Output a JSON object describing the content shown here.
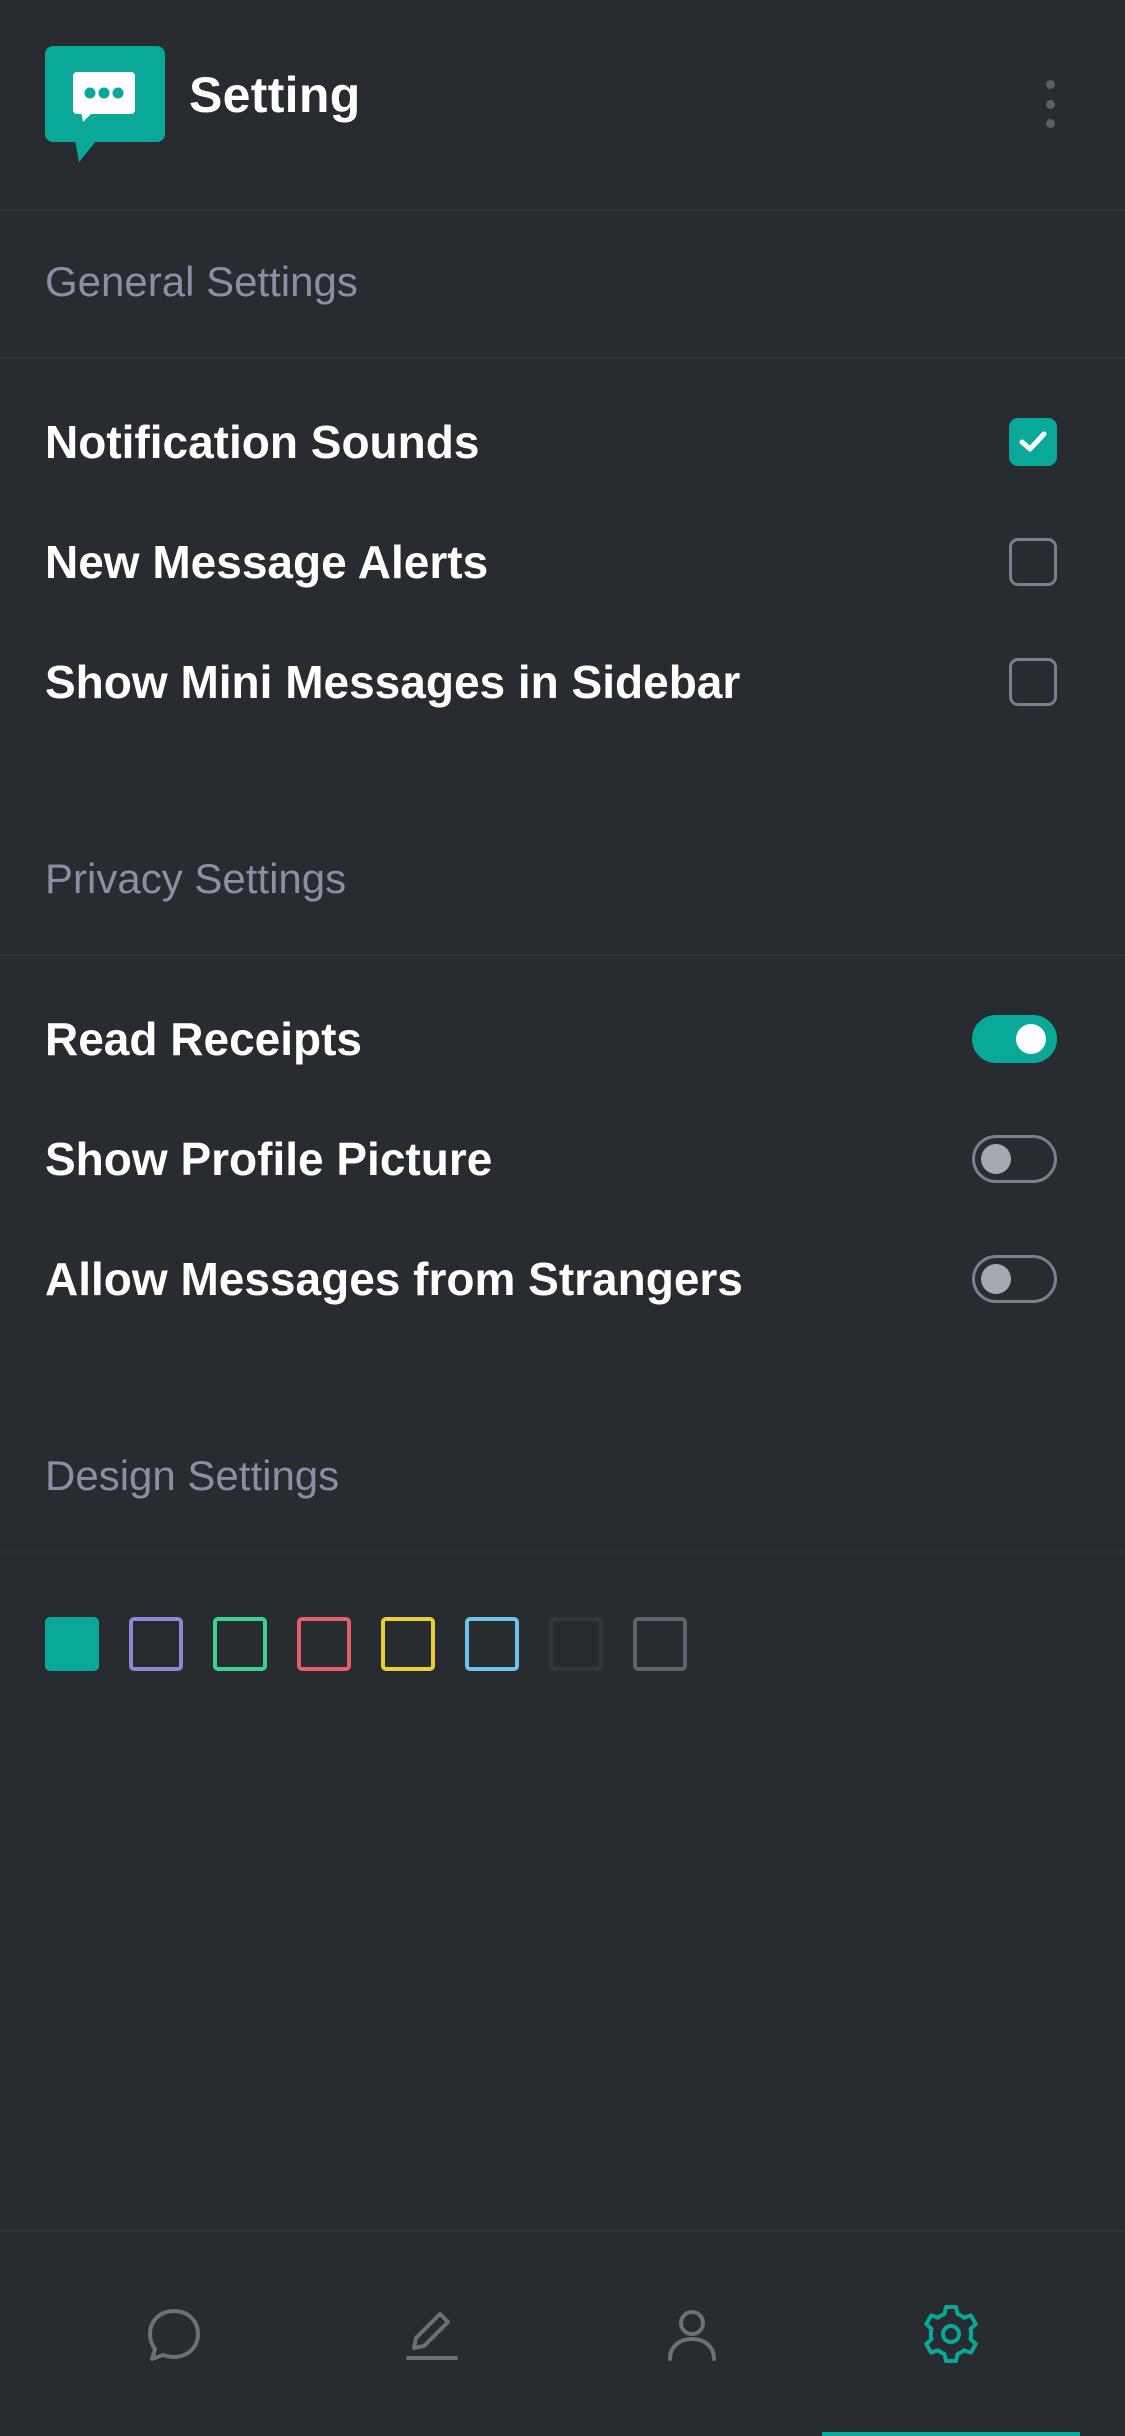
{
  "header": {
    "title": "Setting",
    "logo_icon": "chat-bubble-icon",
    "more_icon": "more-vertical-icon"
  },
  "sections": {
    "general": {
      "heading": "General Settings",
      "items": [
        {
          "label": "Notification Sounds",
          "checked": true
        },
        {
          "label": "New Message Alerts",
          "checked": false
        },
        {
          "label": "Show Mini Messages in Sidebar",
          "checked": false
        }
      ]
    },
    "privacy": {
      "heading": "Privacy Settings",
      "items": [
        {
          "label": "Read Receipts",
          "on": true
        },
        {
          "label": "Show Profile Picture",
          "on": false
        },
        {
          "label": "Allow Messages from Strangers",
          "on": false
        }
      ]
    },
    "design": {
      "heading": "Design Settings",
      "swatches": [
        {
          "color": "#0aa899",
          "selected": true
        },
        {
          "color": "#8e88cf",
          "selected": false
        },
        {
          "color": "#37d38f",
          "selected": false
        },
        {
          "color": "#e35f6a",
          "selected": false
        },
        {
          "color": "#e8cf3a",
          "selected": false
        },
        {
          "color": "#6cc4e8",
          "selected": false
        },
        {
          "color": "#33373b",
          "selected": false
        },
        {
          "color": "#5e646b",
          "selected": false
        }
      ]
    }
  },
  "bottom_nav": {
    "items": [
      {
        "icon": "chat-icon",
        "active": false
      },
      {
        "icon": "pencil-icon",
        "active": false
      },
      {
        "icon": "user-icon",
        "active": false
      },
      {
        "icon": "gear-icon",
        "active": true
      }
    ]
  },
  "colors": {
    "accent": "#0aa899",
    "background": "#282b2f",
    "muted_text": "#8b8fa3",
    "inactive_icon": "#6b7079"
  }
}
